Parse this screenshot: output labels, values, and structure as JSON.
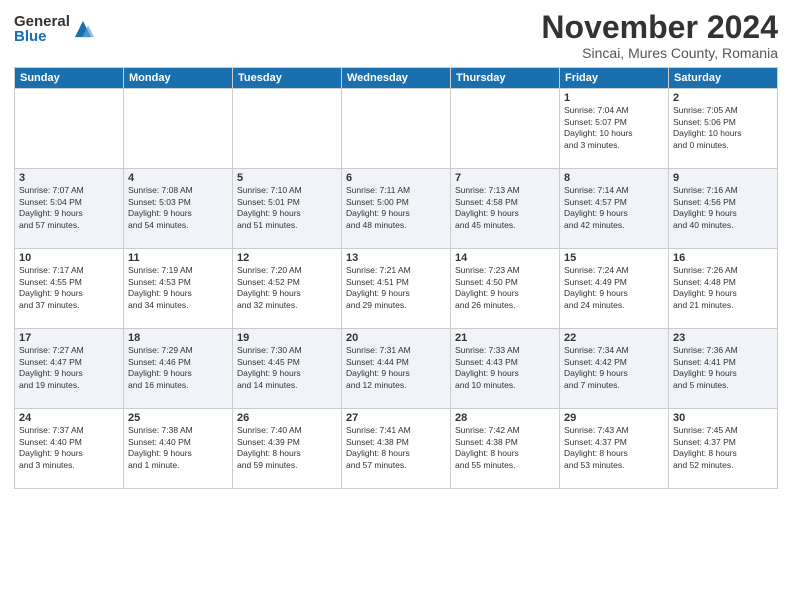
{
  "logo": {
    "general": "General",
    "blue": "Blue"
  },
  "title": "November 2024",
  "subtitle": "Sincai, Mures County, Romania",
  "headers": [
    "Sunday",
    "Monday",
    "Tuesday",
    "Wednesday",
    "Thursday",
    "Friday",
    "Saturday"
  ],
  "weeks": [
    [
      {
        "day": "",
        "info": ""
      },
      {
        "day": "",
        "info": ""
      },
      {
        "day": "",
        "info": ""
      },
      {
        "day": "",
        "info": ""
      },
      {
        "day": "",
        "info": ""
      },
      {
        "day": "1",
        "info": "Sunrise: 7:04 AM\nSunset: 5:07 PM\nDaylight: 10 hours\nand 3 minutes."
      },
      {
        "day": "2",
        "info": "Sunrise: 7:05 AM\nSunset: 5:06 PM\nDaylight: 10 hours\nand 0 minutes."
      }
    ],
    [
      {
        "day": "3",
        "info": "Sunrise: 7:07 AM\nSunset: 5:04 PM\nDaylight: 9 hours\nand 57 minutes."
      },
      {
        "day": "4",
        "info": "Sunrise: 7:08 AM\nSunset: 5:03 PM\nDaylight: 9 hours\nand 54 minutes."
      },
      {
        "day": "5",
        "info": "Sunrise: 7:10 AM\nSunset: 5:01 PM\nDaylight: 9 hours\nand 51 minutes."
      },
      {
        "day": "6",
        "info": "Sunrise: 7:11 AM\nSunset: 5:00 PM\nDaylight: 9 hours\nand 48 minutes."
      },
      {
        "day": "7",
        "info": "Sunrise: 7:13 AM\nSunset: 4:58 PM\nDaylight: 9 hours\nand 45 minutes."
      },
      {
        "day": "8",
        "info": "Sunrise: 7:14 AM\nSunset: 4:57 PM\nDaylight: 9 hours\nand 42 minutes."
      },
      {
        "day": "9",
        "info": "Sunrise: 7:16 AM\nSunset: 4:56 PM\nDaylight: 9 hours\nand 40 minutes."
      }
    ],
    [
      {
        "day": "10",
        "info": "Sunrise: 7:17 AM\nSunset: 4:55 PM\nDaylight: 9 hours\nand 37 minutes."
      },
      {
        "day": "11",
        "info": "Sunrise: 7:19 AM\nSunset: 4:53 PM\nDaylight: 9 hours\nand 34 minutes."
      },
      {
        "day": "12",
        "info": "Sunrise: 7:20 AM\nSunset: 4:52 PM\nDaylight: 9 hours\nand 32 minutes."
      },
      {
        "day": "13",
        "info": "Sunrise: 7:21 AM\nSunset: 4:51 PM\nDaylight: 9 hours\nand 29 minutes."
      },
      {
        "day": "14",
        "info": "Sunrise: 7:23 AM\nSunset: 4:50 PM\nDaylight: 9 hours\nand 26 minutes."
      },
      {
        "day": "15",
        "info": "Sunrise: 7:24 AM\nSunset: 4:49 PM\nDaylight: 9 hours\nand 24 minutes."
      },
      {
        "day": "16",
        "info": "Sunrise: 7:26 AM\nSunset: 4:48 PM\nDaylight: 9 hours\nand 21 minutes."
      }
    ],
    [
      {
        "day": "17",
        "info": "Sunrise: 7:27 AM\nSunset: 4:47 PM\nDaylight: 9 hours\nand 19 minutes."
      },
      {
        "day": "18",
        "info": "Sunrise: 7:29 AM\nSunset: 4:46 PM\nDaylight: 9 hours\nand 16 minutes."
      },
      {
        "day": "19",
        "info": "Sunrise: 7:30 AM\nSunset: 4:45 PM\nDaylight: 9 hours\nand 14 minutes."
      },
      {
        "day": "20",
        "info": "Sunrise: 7:31 AM\nSunset: 4:44 PM\nDaylight: 9 hours\nand 12 minutes."
      },
      {
        "day": "21",
        "info": "Sunrise: 7:33 AM\nSunset: 4:43 PM\nDaylight: 9 hours\nand 10 minutes."
      },
      {
        "day": "22",
        "info": "Sunrise: 7:34 AM\nSunset: 4:42 PM\nDaylight: 9 hours\nand 7 minutes."
      },
      {
        "day": "23",
        "info": "Sunrise: 7:36 AM\nSunset: 4:41 PM\nDaylight: 9 hours\nand 5 minutes."
      }
    ],
    [
      {
        "day": "24",
        "info": "Sunrise: 7:37 AM\nSunset: 4:40 PM\nDaylight: 9 hours\nand 3 minutes."
      },
      {
        "day": "25",
        "info": "Sunrise: 7:38 AM\nSunset: 4:40 PM\nDaylight: 9 hours\nand 1 minute."
      },
      {
        "day": "26",
        "info": "Sunrise: 7:40 AM\nSunset: 4:39 PM\nDaylight: 8 hours\nand 59 minutes."
      },
      {
        "day": "27",
        "info": "Sunrise: 7:41 AM\nSunset: 4:38 PM\nDaylight: 8 hours\nand 57 minutes."
      },
      {
        "day": "28",
        "info": "Sunrise: 7:42 AM\nSunset: 4:38 PM\nDaylight: 8 hours\nand 55 minutes."
      },
      {
        "day": "29",
        "info": "Sunrise: 7:43 AM\nSunset: 4:37 PM\nDaylight: 8 hours\nand 53 minutes."
      },
      {
        "day": "30",
        "info": "Sunrise: 7:45 AM\nSunset: 4:37 PM\nDaylight: 8 hours\nand 52 minutes."
      }
    ]
  ]
}
